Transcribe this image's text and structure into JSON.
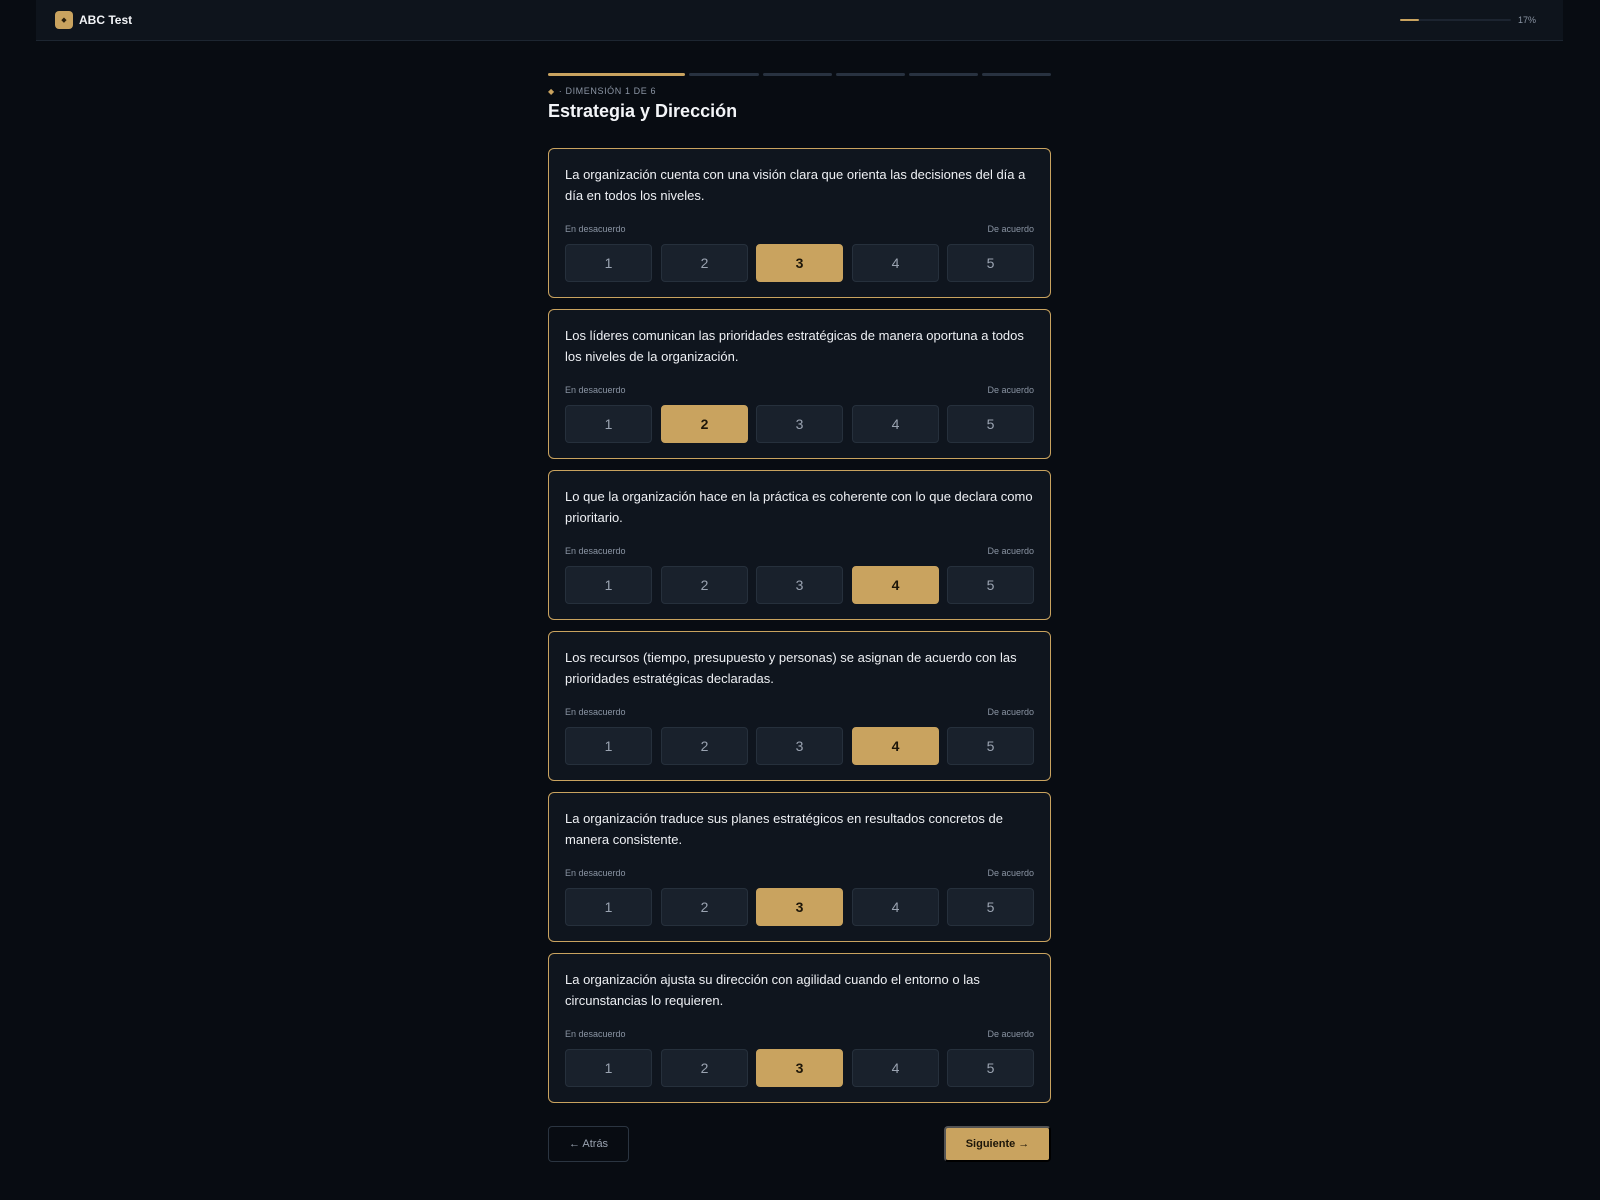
{
  "app": {
    "logo_glyph": "◆",
    "name": "ABC Test",
    "progress": {
      "fraction": 0.17,
      "label": "17%"
    }
  },
  "colors": {
    "accent": "#c9a35f",
    "background": "#080c12",
    "card": "#0f151e"
  },
  "steps": {
    "total": 6,
    "current": 1
  },
  "dimension": {
    "glyph": "◆",
    "label": "· DIMENSIÓN 1 DE 6",
    "title": "Estrategia y Dirección"
  },
  "scale": {
    "left_label": "En desacuerdo",
    "right_label": "De acuerdo",
    "options": [
      "1",
      "2",
      "3",
      "4",
      "5"
    ]
  },
  "questions": [
    {
      "text": "La organización cuenta con una visión clara que orienta las decisiones del día a día en todos los niveles.",
      "selected": 3
    },
    {
      "text": "Los líderes comunican las prioridades estratégicas de manera oportuna a todos los niveles de la organización.",
      "selected": 2
    },
    {
      "text": "Lo que la organización hace en la práctica es coherente con lo que declara como prioritario.",
      "selected": 4
    },
    {
      "text": "Los recursos (tiempo, presupuesto y personas) se asignan de acuerdo con las prioridades estratégicas declaradas.",
      "selected": 4
    },
    {
      "text": "La organización traduce sus planes estratégicos en resultados concretos de manera consistente.",
      "selected": 3
    },
    {
      "text": "La organización ajusta su dirección con agilidad cuando el entorno o las circunstancias lo requieren.",
      "selected": 3
    }
  ],
  "nav": {
    "back_label": "← Atrás",
    "next_label": "Siguiente →"
  }
}
